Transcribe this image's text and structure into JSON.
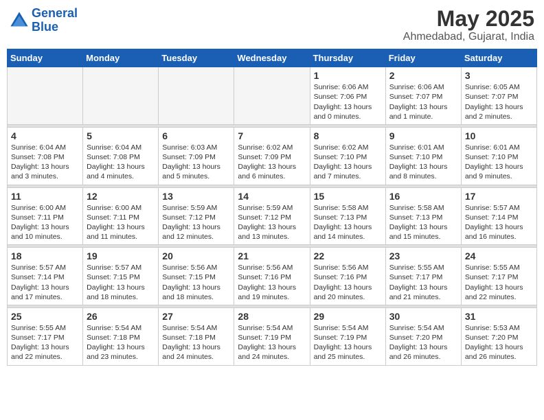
{
  "app": {
    "name": "GeneralBlue",
    "logo_text_part1": "General",
    "logo_text_part2": "Blue"
  },
  "calendar": {
    "month": "May 2025",
    "location": "Ahmedabad, Gujarat, India",
    "weekdays": [
      "Sunday",
      "Monday",
      "Tuesday",
      "Wednesday",
      "Thursday",
      "Friday",
      "Saturday"
    ],
    "weeks": [
      [
        {
          "day": "",
          "info": ""
        },
        {
          "day": "",
          "info": ""
        },
        {
          "day": "",
          "info": ""
        },
        {
          "day": "",
          "info": ""
        },
        {
          "day": "1",
          "info": "Sunrise: 6:06 AM\nSunset: 7:06 PM\nDaylight: 13 hours\nand 0 minutes."
        },
        {
          "day": "2",
          "info": "Sunrise: 6:06 AM\nSunset: 7:07 PM\nDaylight: 13 hours\nand 1 minute."
        },
        {
          "day": "3",
          "info": "Sunrise: 6:05 AM\nSunset: 7:07 PM\nDaylight: 13 hours\nand 2 minutes."
        }
      ],
      [
        {
          "day": "4",
          "info": "Sunrise: 6:04 AM\nSunset: 7:08 PM\nDaylight: 13 hours\nand 3 minutes."
        },
        {
          "day": "5",
          "info": "Sunrise: 6:04 AM\nSunset: 7:08 PM\nDaylight: 13 hours\nand 4 minutes."
        },
        {
          "day": "6",
          "info": "Sunrise: 6:03 AM\nSunset: 7:09 PM\nDaylight: 13 hours\nand 5 minutes."
        },
        {
          "day": "7",
          "info": "Sunrise: 6:02 AM\nSunset: 7:09 PM\nDaylight: 13 hours\nand 6 minutes."
        },
        {
          "day": "8",
          "info": "Sunrise: 6:02 AM\nSunset: 7:10 PM\nDaylight: 13 hours\nand 7 minutes."
        },
        {
          "day": "9",
          "info": "Sunrise: 6:01 AM\nSunset: 7:10 PM\nDaylight: 13 hours\nand 8 minutes."
        },
        {
          "day": "10",
          "info": "Sunrise: 6:01 AM\nSunset: 7:10 PM\nDaylight: 13 hours\nand 9 minutes."
        }
      ],
      [
        {
          "day": "11",
          "info": "Sunrise: 6:00 AM\nSunset: 7:11 PM\nDaylight: 13 hours\nand 10 minutes."
        },
        {
          "day": "12",
          "info": "Sunrise: 6:00 AM\nSunset: 7:11 PM\nDaylight: 13 hours\nand 11 minutes."
        },
        {
          "day": "13",
          "info": "Sunrise: 5:59 AM\nSunset: 7:12 PM\nDaylight: 13 hours\nand 12 minutes."
        },
        {
          "day": "14",
          "info": "Sunrise: 5:59 AM\nSunset: 7:12 PM\nDaylight: 13 hours\nand 13 minutes."
        },
        {
          "day": "15",
          "info": "Sunrise: 5:58 AM\nSunset: 7:13 PM\nDaylight: 13 hours\nand 14 minutes."
        },
        {
          "day": "16",
          "info": "Sunrise: 5:58 AM\nSunset: 7:13 PM\nDaylight: 13 hours\nand 15 minutes."
        },
        {
          "day": "17",
          "info": "Sunrise: 5:57 AM\nSunset: 7:14 PM\nDaylight: 13 hours\nand 16 minutes."
        }
      ],
      [
        {
          "day": "18",
          "info": "Sunrise: 5:57 AM\nSunset: 7:14 PM\nDaylight: 13 hours\nand 17 minutes."
        },
        {
          "day": "19",
          "info": "Sunrise: 5:57 AM\nSunset: 7:15 PM\nDaylight: 13 hours\nand 18 minutes."
        },
        {
          "day": "20",
          "info": "Sunrise: 5:56 AM\nSunset: 7:15 PM\nDaylight: 13 hours\nand 18 minutes."
        },
        {
          "day": "21",
          "info": "Sunrise: 5:56 AM\nSunset: 7:16 PM\nDaylight: 13 hours\nand 19 minutes."
        },
        {
          "day": "22",
          "info": "Sunrise: 5:56 AM\nSunset: 7:16 PM\nDaylight: 13 hours\nand 20 minutes."
        },
        {
          "day": "23",
          "info": "Sunrise: 5:55 AM\nSunset: 7:17 PM\nDaylight: 13 hours\nand 21 minutes."
        },
        {
          "day": "24",
          "info": "Sunrise: 5:55 AM\nSunset: 7:17 PM\nDaylight: 13 hours\nand 22 minutes."
        }
      ],
      [
        {
          "day": "25",
          "info": "Sunrise: 5:55 AM\nSunset: 7:17 PM\nDaylight: 13 hours\nand 22 minutes."
        },
        {
          "day": "26",
          "info": "Sunrise: 5:54 AM\nSunset: 7:18 PM\nDaylight: 13 hours\nand 23 minutes."
        },
        {
          "day": "27",
          "info": "Sunrise: 5:54 AM\nSunset: 7:18 PM\nDaylight: 13 hours\nand 24 minutes."
        },
        {
          "day": "28",
          "info": "Sunrise: 5:54 AM\nSunset: 7:19 PM\nDaylight: 13 hours\nand 24 minutes."
        },
        {
          "day": "29",
          "info": "Sunrise: 5:54 AM\nSunset: 7:19 PM\nDaylight: 13 hours\nand 25 minutes."
        },
        {
          "day": "30",
          "info": "Sunrise: 5:54 AM\nSunset: 7:20 PM\nDaylight: 13 hours\nand 26 minutes."
        },
        {
          "day": "31",
          "info": "Sunrise: 5:53 AM\nSunset: 7:20 PM\nDaylight: 13 hours\nand 26 minutes."
        }
      ]
    ]
  }
}
